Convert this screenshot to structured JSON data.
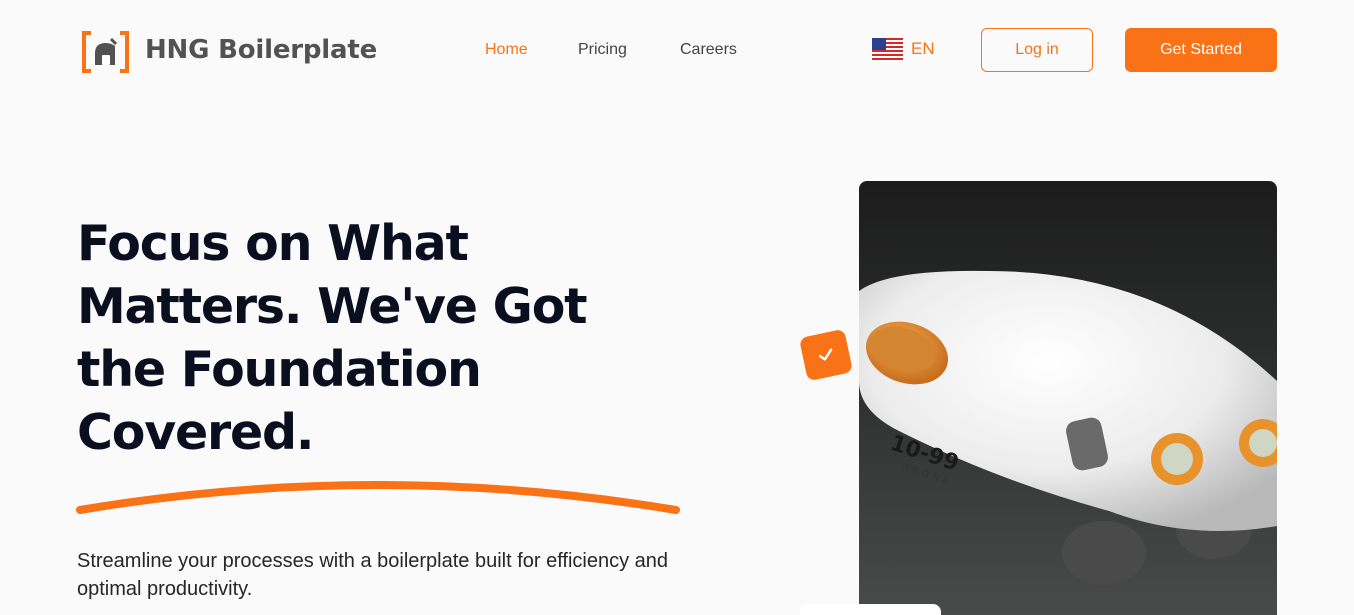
{
  "header": {
    "brand": "HNG Boilerplate",
    "nav": [
      "Home",
      "Pricing",
      "Careers"
    ],
    "language": "EN",
    "login_label": "Log in",
    "get_started_label": "Get Started",
    "accent_color": "#f97316"
  },
  "hero": {
    "title": "Focus on What Matters. We've Got the Foundation Covered.",
    "subtitle": "Streamline your processes with a boilerplate built for efficiency and optimal productivity.",
    "image_text_number": "10-99",
    "image_text_word": "DRONE"
  },
  "icons": {
    "logo": "bracket-logo-icon",
    "flag": "us-flag-icon",
    "badge": "checkmark-icon"
  }
}
